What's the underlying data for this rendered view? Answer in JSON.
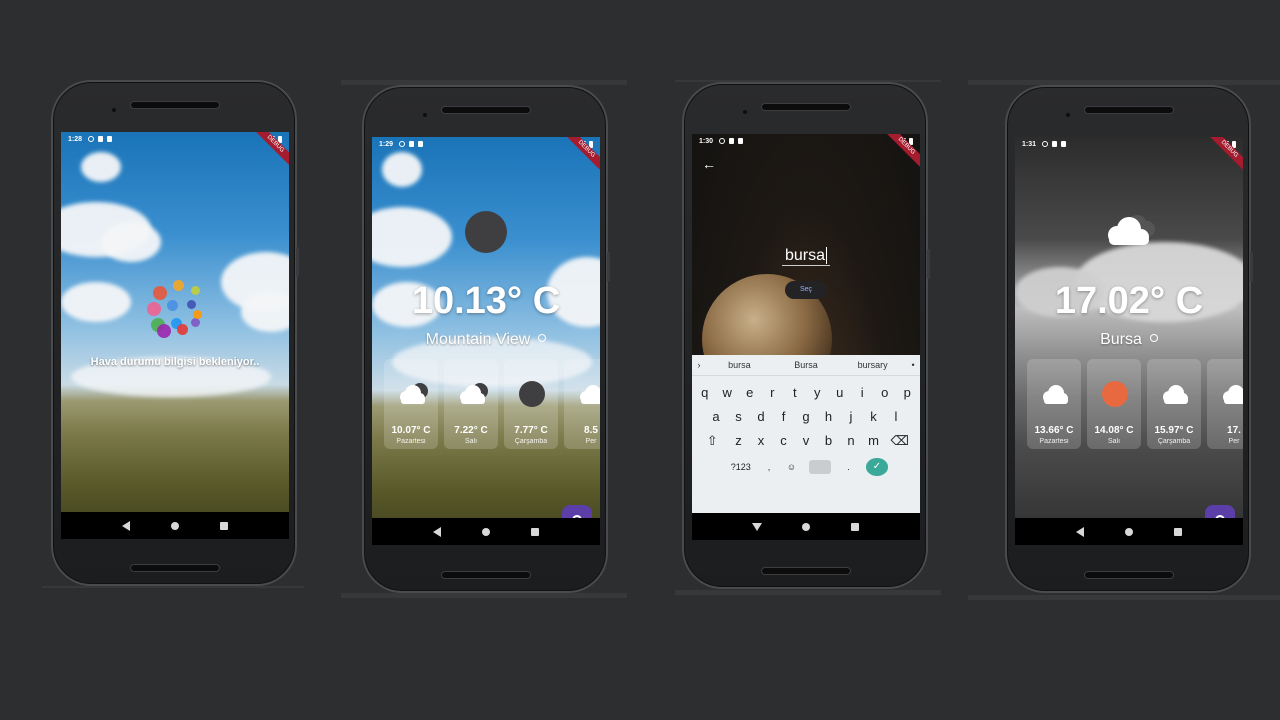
{
  "colors": {
    "background": "#2d2e30",
    "accent": "#5b3ea8",
    "debug_banner": "#a41c2e",
    "sun": "#e8693f"
  },
  "debug_banner": "DEBUG",
  "phone1": {
    "status_time": "1:28",
    "loading_text": "Hava durumu bilgisi bekleniyor..",
    "loader_dots": [
      "#e8583c",
      "#f5a623",
      "#c0d03a",
      "#f06292",
      "#4a90e2",
      "#3f51b5",
      "#4caf50",
      "#2196f3",
      "#7e57c2",
      "#9c27b0",
      "#e53935",
      "#ff9800"
    ]
  },
  "phone2": {
    "status_time": "1:29",
    "temperature": "10.13° C",
    "city": "Mountain View",
    "forecast": [
      {
        "temp": "10.07° C",
        "day": "Pazartesi",
        "icon": "cloud-moon-icon"
      },
      {
        "temp": "7.22° C",
        "day": "Salı",
        "icon": "cloud-moon-icon"
      },
      {
        "temp": "7.77° C",
        "day": "Çarşamba",
        "icon": "moon-icon"
      },
      {
        "temp": "8.5",
        "day": "Per",
        "icon": "cloud-icon"
      }
    ]
  },
  "phone3": {
    "status_time": "1:30",
    "input_value": "bursa",
    "select_button": "Seç",
    "suggestions": [
      "bursa",
      "Bursa",
      "bursary"
    ],
    "row1": [
      "q",
      "w",
      "e",
      "r",
      "t",
      "y",
      "u",
      "i",
      "o",
      "p"
    ],
    "row2": [
      "a",
      "s",
      "d",
      "f",
      "g",
      "h",
      "j",
      "k",
      "l"
    ],
    "row3": [
      "z",
      "x",
      "c",
      "v",
      "b",
      "n",
      "m"
    ],
    "sym_key": "?123",
    "comma_key": ",",
    "period_key": "."
  },
  "phone4": {
    "status_time": "1:31",
    "temperature": "17.02° C",
    "city": "Bursa",
    "forecast": [
      {
        "temp": "13.66° C",
        "day": "Pazartesi",
        "icon": "cloud-icon"
      },
      {
        "temp": "14.08° C",
        "day": "Salı",
        "icon": "sun-icon"
      },
      {
        "temp": "15.97° C",
        "day": "Çarşamba",
        "icon": "cloud-icon"
      },
      {
        "temp": "17.",
        "day": "Per",
        "icon": "cloud-icon"
      }
    ]
  }
}
